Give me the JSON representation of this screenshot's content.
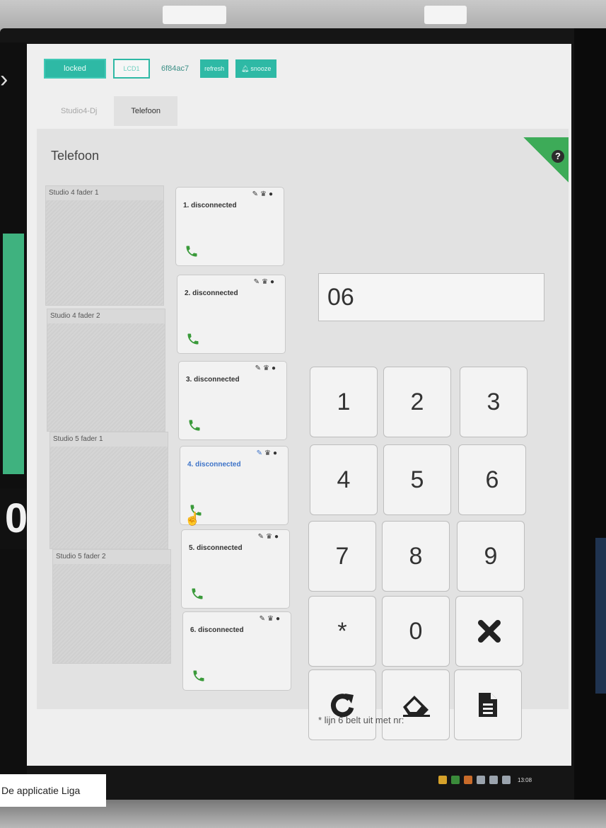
{
  "toolbar": {
    "locked_label": "locked",
    "lcd_label": "LCD1",
    "session_id": "6f84ac7",
    "refresh_label": "refresh",
    "snooze_label": "snooze"
  },
  "tabs": [
    {
      "label": "Studio4-Dj",
      "active": false
    },
    {
      "label": "Telefoon",
      "active": true
    }
  ],
  "panel": {
    "title": "Telefoon",
    "help_glyph": "?"
  },
  "faders": [
    {
      "label": "Studio 4 fader 1"
    },
    {
      "label": "Studio 4 fader 2"
    },
    {
      "label": "Studio 5 fader 1"
    },
    {
      "label": "Studio 5 fader 2"
    }
  ],
  "lines": [
    {
      "status": "1. disconnected",
      "selected": false
    },
    {
      "status": "2. disconnected",
      "selected": false
    },
    {
      "status": "3. disconnected",
      "selected": false
    },
    {
      "status": "4. disconnected",
      "selected": true
    },
    {
      "status": "5. disconnected",
      "selected": false
    },
    {
      "status": "6. disconnected",
      "selected": false
    }
  ],
  "line_icons": [
    "pencil-icon",
    "trophy-icon",
    "circle-icon"
  ],
  "dialer": {
    "display_value": "06",
    "keys": [
      "1",
      "2",
      "3",
      "4",
      "5",
      "6",
      "7",
      "8",
      "9",
      "*",
      "0"
    ],
    "action_icons": [
      "close-icon",
      "redo-icon",
      "eraser-icon",
      "document-icon"
    ],
    "footnote": "* lijn 6 belt uit met nr:"
  },
  "taskbar": {
    "time": "13:08"
  },
  "caption": "De applicatie Liga",
  "colors": {
    "accent": "#2eb9a5",
    "help": "#3dab58",
    "phone": "#3a9a3a",
    "selected": "#3d73c8"
  }
}
